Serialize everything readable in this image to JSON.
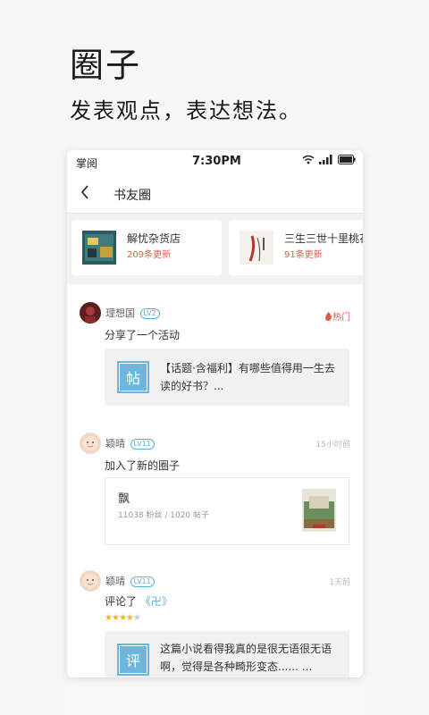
{
  "promo": {
    "title": "圈子",
    "subtitle": "发表观点，表达想法。"
  },
  "statusbar": {
    "carrier": "掌阅",
    "time": "7:30PM"
  },
  "navbar": {
    "title": "书友圈"
  },
  "circles": [
    {
      "name": "解忧杂货店",
      "updates": "209条更新"
    },
    {
      "name": "三生三世十里桃花",
      "updates": "91条更新"
    }
  ],
  "feed": {
    "post1": {
      "user": "理想国",
      "level": "LV2",
      "tag": "热门",
      "action": "分享了一个活动",
      "badge": "帖",
      "quote": "【话题·含福利】有哪些值得用一生去读的好书？..."
    },
    "post2": {
      "user": "颖晴",
      "level": "LV11",
      "time": "15小时前",
      "action": "加入了新的圈子",
      "group_name": "飘",
      "group_meta": "11038 粉丝 / 1020 帖子"
    },
    "post3": {
      "user": "颖晴",
      "level": "LV11",
      "time": "1天前",
      "action_prefix": "评论了",
      "book": "《卍》",
      "rating": 4,
      "badge": "评",
      "quote": "这篇小说看得我真的是很无语很无语啊，觉得是各种畸形变态...... ..."
    }
  },
  "colors": {
    "accent": "#5ab0d6",
    "hot": "#e05a44",
    "badge": "#6fb6dc",
    "star": "#f0b429"
  }
}
